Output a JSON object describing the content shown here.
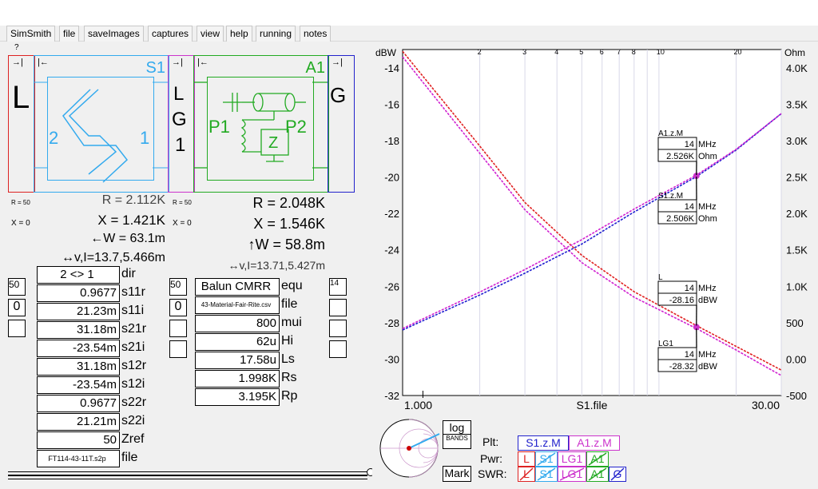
{
  "menu": [
    "SimSmith",
    "file",
    "saveImages",
    "captures",
    "view",
    "help",
    "running",
    "notes"
  ],
  "help_mark": "?",
  "left_block": {
    "letter": "L",
    "arrow": "→⇥"
  },
  "s1": {
    "name": "S1",
    "port2": "2",
    "port1": "1"
  },
  "lg1": {
    "l1": "L",
    "l2": "G",
    "l3": "1"
  },
  "a1": {
    "name": "A1",
    "p1": "P1",
    "p2": "P2"
  },
  "g_block": {
    "letter": "G"
  },
  "readouts_s1": {
    "r": "R = 2.112K",
    "x": "X = 1.421K",
    "w": "←W = 63.1m",
    "vi": "↔v,I=13.7,5.466m"
  },
  "readouts_a1": {
    "r": "R = 2.048K",
    "x": "X = 1.546K",
    "w": "↑W = 58.8m",
    "vi": "↔v,I=13.71,5.427m"
  },
  "small_labels": {
    "r50a": "R = 50",
    "x0a": "X = 0",
    "r50b": "R = 50",
    "x0b": "X = 0"
  },
  "s_params": [
    {
      "value": "2 <> 1",
      "label": "dir"
    },
    {
      "value": "0.9677",
      "label": "s11r"
    },
    {
      "value": "21.23m",
      "label": "s11i"
    },
    {
      "value": "31.18m",
      "label": "s21r"
    },
    {
      "value": "-23.54m",
      "label": "s21i"
    },
    {
      "value": "31.18m",
      "label": "s12r"
    },
    {
      "value": "-23.54m",
      "label": "s12i"
    },
    {
      "value": "0.9677",
      "label": "s22r"
    },
    {
      "value": "21.21m",
      "label": "s22i"
    },
    {
      "value": "50",
      "label": "Zref"
    },
    {
      "value": "FT114-43-11T.s2p",
      "label": "file"
    }
  ],
  "a_params": [
    {
      "value": "Balun CMRR",
      "label": "equ"
    },
    {
      "value": "43-Material-Fair-Rite.csv",
      "label": "file"
    },
    {
      "value": "800",
      "label": "mui"
    },
    {
      "value": "62u",
      "label": "Hi"
    },
    {
      "value": "17.58u",
      "label": "Ls"
    },
    {
      "value": "1.998K",
      "label": "Rs"
    },
    {
      "value": "3.195K",
      "label": "Rp"
    }
  ],
  "side_ctl": {
    "l50": "50",
    "l0": "0",
    "r50": "50",
    "r0": "0",
    "r14": "14"
  },
  "chart_data": {
    "type": "line",
    "xlabel": "S1.file",
    "x_left_label": "1.000",
    "x_right_label": "30.00",
    "x_scale": "log",
    "xlim": [
      1,
      30
    ],
    "x_top_ticks": [
      "2",
      "3",
      "4",
      "5",
      "6",
      "7",
      "8",
      "10",
      "20"
    ],
    "y_left_unit": "dBW",
    "ylim_left": [
      -32,
      -13
    ],
    "y_left_ticks": [
      "-14",
      "-16",
      "-18",
      "-20",
      "-22",
      "-24",
      "-26",
      "-28",
      "-30",
      "-32"
    ],
    "y_right_unit": "Ohm",
    "ylim_right": [
      -500,
      4250
    ],
    "y_right_ticks": [
      "4.0K",
      "3.5K",
      "3.0K",
      "2.5K",
      "2.0K",
      "1.5K",
      "1.0K",
      "500",
      "0.00",
      "-500"
    ],
    "series": [
      {
        "name": "L",
        "axis": "left",
        "color": "#e02020",
        "x": [
          1,
          2,
          3,
          5,
          8,
          14,
          20,
          30
        ],
        "y": [
          -13.1,
          -18.3,
          -21.4,
          -24.3,
          -26.3,
          -28.16,
          -29.3,
          -30.6
        ]
      },
      {
        "name": "LG1",
        "axis": "left",
        "color": "#d020d0",
        "x": [
          1,
          2,
          3,
          5,
          8,
          14,
          20,
          30
        ],
        "y": [
          -13.4,
          -18.7,
          -21.8,
          -24.7,
          -26.6,
          -28.32,
          -29.5,
          -30.9
        ]
      },
      {
        "name": "S1.z.M",
        "axis": "right",
        "color": "#2020d0",
        "x": [
          1,
          2,
          3,
          5,
          8,
          14,
          20,
          30
        ],
        "y": [
          400,
          880,
          1180,
          1580,
          2020,
          2506,
          2870,
          3370
        ]
      },
      {
        "name": "A1.z.M",
        "axis": "right",
        "color": "#d020d0",
        "x": [
          1,
          2,
          3,
          5,
          8,
          14,
          20,
          30
        ],
        "y": [
          420,
          920,
          1230,
          1640,
          2060,
          2526,
          2880,
          3370
        ]
      }
    ],
    "markers": [
      {
        "title": "A1.z.M",
        "freq": "14",
        "freq_unit": "MHz",
        "value": "2.526K",
        "unit": "Ohm"
      },
      {
        "title": "S1.z.M",
        "freq": "14",
        "freq_unit": "MHz",
        "value": "2.506K",
        "unit": "Ohm"
      },
      {
        "title": "L",
        "freq": "14",
        "freq_unit": "MHz",
        "value": "-28.16",
        "unit": "dBW"
      },
      {
        "title": "LG1",
        "freq": "14",
        "freq_unit": "MHz",
        "value": "-28.32",
        "unit": "dBW"
      }
    ]
  },
  "bottom": {
    "log": "log",
    "bands": "BANDS",
    "mark": "Mark",
    "plt": "Plt:",
    "pwr": "Pwr:",
    "swr": "SWR:",
    "plt_items": [
      "S1.z.M",
      "A1.z.M"
    ],
    "pwr_items": [
      "L",
      "S1",
      "LG1",
      "A1"
    ],
    "swr_items": [
      "L",
      "S1",
      "LG1",
      "A1",
      "G"
    ]
  },
  "colors": {
    "s1": "#33aaee",
    "a1": "#22aa22",
    "lg1": "#cc33cc",
    "l": "#dd2222",
    "g": "#2222cc"
  }
}
